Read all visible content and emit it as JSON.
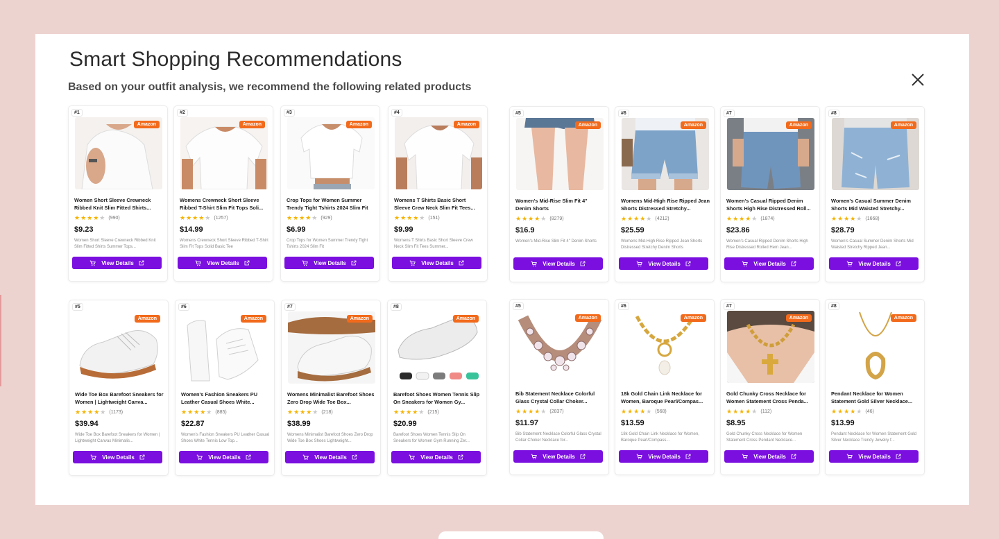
{
  "modal": {
    "title": "Smart Shopping Recommendations",
    "subtitle": "Based on your outfit analysis, we recommend the following related products"
  },
  "common": {
    "badge": "Amazon",
    "button_label": "View Details"
  },
  "colors": {
    "button": "#7a0fe0",
    "badge": "#f26a1b",
    "star": "#f5b301",
    "backdrop": "#edd3d0"
  },
  "groups": [
    {
      "category": "tops",
      "products": [
        {
          "rank": "#1",
          "name": "Women Short Sleeve Crewneck Ribbed Knit Slim Fitted Shirts...",
          "stars": 4,
          "reviews": "(990)",
          "price": "$9.23",
          "desc": "Women Short Sleeve Crewneck Ribbed Knit Slim Fitted Shirts Summer Tops..."
        },
        {
          "rank": "#2",
          "name": "Womens Crewneck Short Sleeve Ribbed T-Shirt Slim Fit Tops Soli...",
          "stars": 4,
          "reviews": "(1257)",
          "price": "$14.99",
          "desc": "Womens Crewneck Short Sleeve Ribbed T-Shirt Slim Fit Tops Solid Basic Tee"
        },
        {
          "rank": "#3",
          "name": "Crop Tops for Women Summer Trendy Tight Tshirts 2024 Slim Fit",
          "stars": 4,
          "reviews": "(929)",
          "price": "$6.99",
          "desc": "Crop Tops for Women Summer Trendy Tight Tshirts 2024 Slim Fit"
        },
        {
          "rank": "#4",
          "name": "Womens T Shirts Basic Short Sleeve Crew Neck Slim Fit Tees...",
          "stars": 4,
          "reviews": "(151)",
          "price": "$9.99",
          "desc": "Womens T Shirts Basic Short Sleeve Crew Neck Slim Fit Tees Summer..."
        }
      ]
    },
    {
      "category": "shorts",
      "products": [
        {
          "rank": "#5",
          "name": "Women's Mid-Rise Slim Fit 4\" Denim Shorts",
          "stars": 4,
          "reviews": "(8279)",
          "price": "$16.9",
          "desc": "Women's Mid-Rise Slim Fit 4\" Denim Shorts"
        },
        {
          "rank": "#6",
          "name": "Womens Mid-High Rise Ripped Jean Shorts Distressed Stretchy...",
          "stars": 4,
          "reviews": "(4212)",
          "price": "$25.59",
          "desc": "Womens Mid-High Rise Ripped Jean Shorts Distressed Stretchy Denim Shorts"
        },
        {
          "rank": "#7",
          "name": "Women's Casual Ripped Denim Shorts High Rise Distressed Roll...",
          "stars": 4,
          "reviews": "(1874)",
          "price": "$23.86",
          "desc": "Women's Casual Ripped Denim Shorts High Rise Distressed Rolled Hem Jean..."
        },
        {
          "rank": "#8",
          "name": "Women's Casual Summer Denim Shorts Mid Waisted Stretchy...",
          "stars": 4,
          "reviews": "(1668)",
          "price": "$28.79",
          "desc": "Women's Casual Summer Denim Shorts Mid Waisted Stretchy Ripped Jean..."
        }
      ]
    },
    {
      "category": "shoes",
      "products": [
        {
          "rank": "#5",
          "name": "Wide Toe Box Barefoot Sneakers for Women | Lightweight Canva...",
          "stars": 4,
          "reviews": "(1173)",
          "price": "$39.94",
          "desc": "Wide Toe Box Barefoot Sneakers for Women | Lightweight Canvas Minimalis..."
        },
        {
          "rank": "#6",
          "name": "Women's Fashion Sneakers PU Leather Casual Shoes White...",
          "stars": 4,
          "reviews": "(885)",
          "price": "$22.87",
          "desc": "Women's Fashion Sneakers PU Leather Casual Shoes White Tennis Low Top..."
        },
        {
          "rank": "#7",
          "name": "Womens Minimalist Barefoot Shoes Zero Drop Wide Toe Box...",
          "stars": 4,
          "reviews": "(218)",
          "price": "$38.99",
          "desc": "Womens Minimalist Barefoot Shoes Zero Drop Wide Toe Box Shoes Lightweight..."
        },
        {
          "rank": "#8",
          "name": "Barefoot Shoes Women Tennis Slip On Sneakers for Women Gy...",
          "stars": 4,
          "reviews": "(215)",
          "price": "$20.99",
          "desc": "Barefoot Shoes Women Tennis Slip On Sneakers for Women Gym Running Zer..."
        }
      ]
    },
    {
      "category": "necklaces",
      "products": [
        {
          "rank": "#5",
          "name": "Bib Statement Necklace Colorful Glass Crystal Collar Choker...",
          "stars": 4,
          "reviews": "(2837)",
          "price": "$11.97",
          "desc": "Bib Statement Necklace Colorful Glass Crystal Collar Choker Necklace for..."
        },
        {
          "rank": "#6",
          "name": "18k Gold Chain Link Necklace for Women, Baroque Pearl/Compas...",
          "stars": 4,
          "reviews": "(568)",
          "price": "$13.59",
          "desc": "18k Gold Chain Link Necklace for Women, Baroque Pearl/Compass..."
        },
        {
          "rank": "#7",
          "name": "Gold Chunky Cross Necklace for Women Statement Cross Penda...",
          "stars": 4,
          "reviews": "(112)",
          "price": "$8.95",
          "desc": "Gold Chunky Cross Necklace for Women Statement Cross Pendant Necklace..."
        },
        {
          "rank": "#8",
          "name": "Pendant Necklace for Women Statement Gold Silver Necklace...",
          "stars": 4,
          "reviews": "(46)",
          "price": "$13.99",
          "desc": "Pendant Necklace for Women Statement Gold Silver Necklace Trendy Jewelry f..."
        }
      ]
    }
  ]
}
